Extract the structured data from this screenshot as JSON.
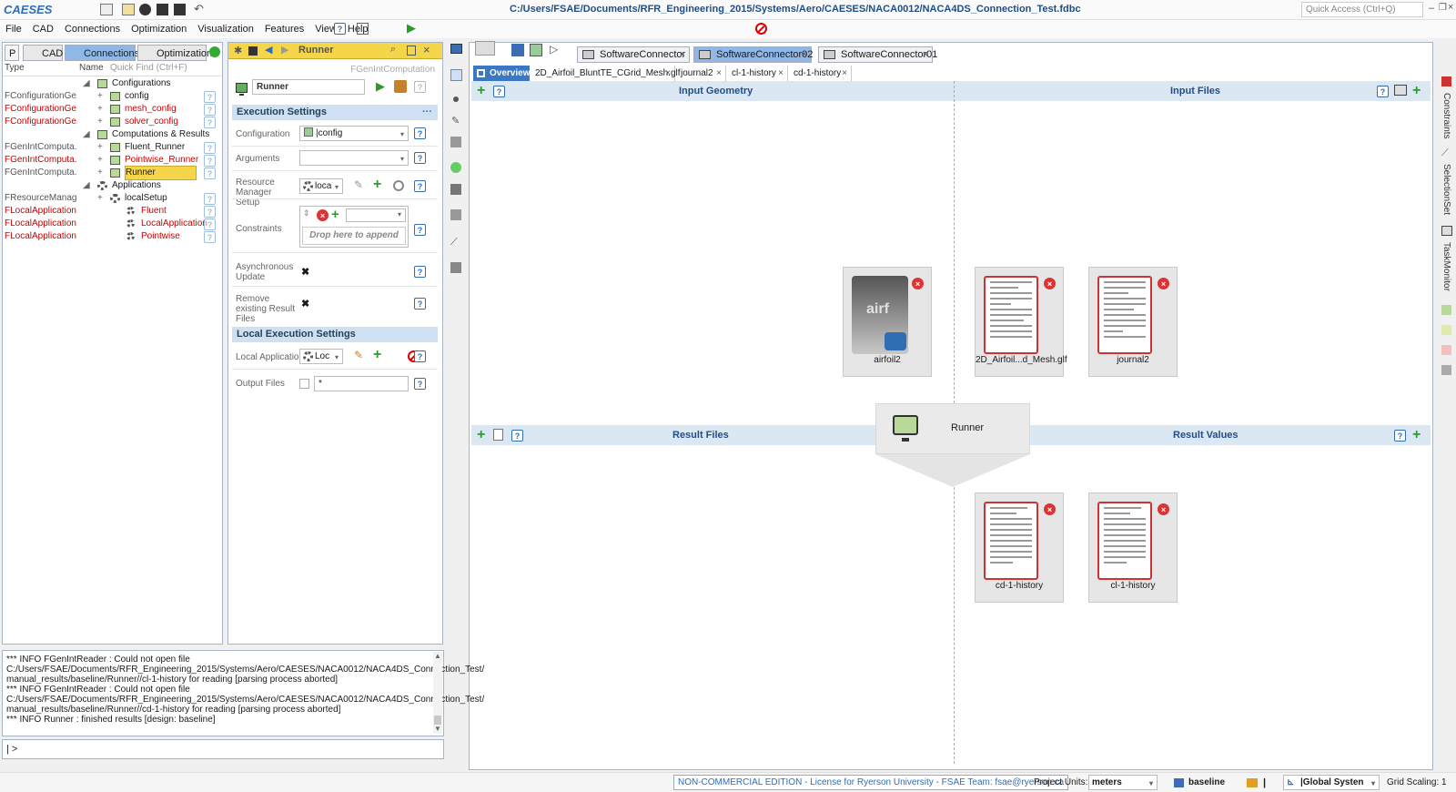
{
  "app": {
    "logo": "CAESES",
    "title": "C:/Users/FSAE/Documents/RFR_Engineering_2015/Systems/Aero/CAESES/NACA0012/NACA4DS_Connection_Test.fdbc",
    "quick_access": "Quick Access (Ctrl+Q)"
  },
  "menu": [
    "File",
    "CAD",
    "Connections",
    "Optimization",
    "Visualization",
    "Features",
    "View",
    "Help"
  ],
  "left_panel": {
    "tabs": {
      "p": "P",
      "cad": "CAD",
      "connections": "Connections",
      "optimization": "Optimization"
    },
    "header": {
      "type": "Type",
      "name": "Name",
      "quick_find": "Quick Find (Ctrl+F)"
    },
    "tree": [
      {
        "type": "",
        "name": "Configurations",
        "group": true,
        "indent": 1
      },
      {
        "type": "FConfigurationGe...",
        "name": "config",
        "indent": 2,
        "normal": true
      },
      {
        "type": "FConfigurationGe...",
        "name": "mesh_config",
        "indent": 2
      },
      {
        "type": "FConfigurationGe...",
        "name": "solver_config",
        "indent": 2
      },
      {
        "type": "",
        "name": "Computations & Results",
        "group": true,
        "indent": 1
      },
      {
        "type": "FGenIntComputa...",
        "name": "Fluent_Runner",
        "indent": 2,
        "normal": true
      },
      {
        "type": "FGenIntComputa...",
        "name": "Pointwise_Runner",
        "indent": 2
      },
      {
        "type": "FGenIntComputa...",
        "name": "Runner",
        "indent": 2,
        "normal": true,
        "selected": true
      },
      {
        "type": "",
        "name": "Applications",
        "group": true,
        "indent": 1
      },
      {
        "type": "FResourceManag...",
        "name": "localSetup",
        "indent": 2,
        "normal": true
      },
      {
        "type": "FLocalApplication",
        "name": "Fluent",
        "indent": 3
      },
      {
        "type": "FLocalApplication",
        "name": "LocalApplication",
        "indent": 3
      },
      {
        "type": "FLocalApplication",
        "name": "Pointwise",
        "indent": 3
      }
    ]
  },
  "runner_panel": {
    "title": "Runner",
    "type_label": "FGenIntComputation",
    "name_value": "Runner",
    "execution_settings": "Execution Settings",
    "configuration_label": "Configuration",
    "configuration_value": "|config",
    "arguments_label": "Arguments",
    "arguments_value": "",
    "resource_label": "Resource Manager Setup",
    "resource_value": "loca",
    "constraints_label": "Constraints",
    "drop_text": "Drop here to append",
    "async_label": "Asynchronous Update",
    "remove_label": "Remove existing Result Files",
    "local_settings": "Local Execution Settings",
    "local_app_label": "Local Application",
    "local_app_value": "Loc",
    "output_label": "Output Files",
    "output_value": "*"
  },
  "doc_tabs": [
    "SoftwareConnector",
    "SoftwareConnector02",
    "SoftwareConnector01"
  ],
  "editor_tabs": [
    "Overview",
    "2D_Airfoil_BluntTE_CGrid_Mesh.glf",
    "journal2",
    "cl-1-history",
    "cd-1-history"
  ],
  "overview": {
    "input_geometry": "Input Geometry",
    "input_files": "Input Files",
    "result_files": "Result Files",
    "result_values": "Result Values",
    "runner_label": "Runner",
    "airfoil_thumb": "airf",
    "inputs": [
      {
        "label": "airfoil2",
        "kind": "geometry"
      },
      {
        "label": "2D_Airfoil...d_Mesh.glf",
        "kind": "file"
      },
      {
        "label": "journal2",
        "kind": "file"
      }
    ],
    "results": [
      {
        "label": "cd-1-history"
      },
      {
        "label": "cl-1-history"
      }
    ]
  },
  "log": [
    "*** INFO FGenIntReader : Could not open file",
    "C:/Users/FSAE/Documents/RFR_Engineering_2015/Systems/Aero/CAESES/NACA0012/NACA4DS_Connection_Test/",
    "manual_results/baseline/Runner//cl-1-history for reading [parsing process aborted]",
    "*** INFO FGenIntReader : Could not open file",
    "C:/Users/FSAE/Documents/RFR_Engineering_2015/Systems/Aero/CAESES/NACA0012/NACA4DS_Connection_Test/",
    "manual_results/baseline/Runner//cd-1-history for reading [parsing process aborted]",
    "*** INFO Runner : finished results [design: baseline]"
  ],
  "prompt": "| >",
  "status": {
    "license": "NON-COMMERCIAL EDITION - License for Ryerson University - FSAE Team: fsae@ryerson.ca",
    "units_label": "Project Units:",
    "units_value": "meters",
    "design": "baseline",
    "coord_system": "|Global Systen",
    "grid_scaling": "Grid Scaling: 1"
  },
  "side_labels": [
    "Constraints",
    "SelectionSet",
    "TaskMonitor"
  ],
  "colors": {
    "accent": "#2f6db5",
    "header_bar": "#dce7f4",
    "file_border": "#cc3333",
    "type_red": "#cc0000",
    "runner_header": "#f5d54a"
  }
}
